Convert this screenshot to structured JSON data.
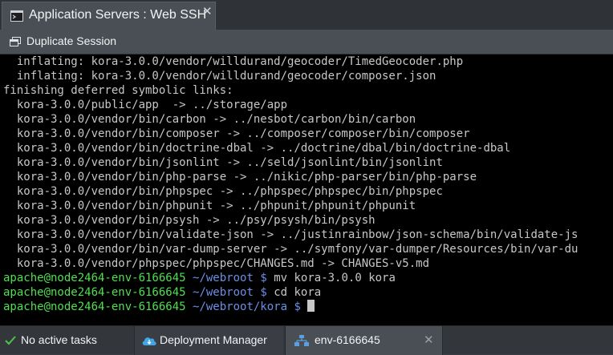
{
  "window": {
    "tab_title": "Application Servers : Web SSH",
    "tab_close": "✕"
  },
  "toolbar": {
    "duplicate_label": "Duplicate Session"
  },
  "terminal": {
    "output_lines": [
      "  inflating: kora-3.0.0/vendor/willdurand/geocoder/TimedGeocoder.php",
      "  inflating: kora-3.0.0/vendor/willdurand/geocoder/composer.json",
      "finishing deferred symbolic links:",
      "  kora-3.0.0/public/app  -> ../storage/app",
      "  kora-3.0.0/vendor/bin/carbon -> ../nesbot/carbon/bin/carbon",
      "  kora-3.0.0/vendor/bin/composer -> ../composer/composer/bin/composer",
      "  kora-3.0.0/vendor/bin/doctrine-dbal -> ../doctrine/dbal/bin/doctrine-dbal",
      "  kora-3.0.0/vendor/bin/jsonlint -> ../seld/jsonlint/bin/jsonlint",
      "  kora-3.0.0/vendor/bin/php-parse -> ../nikic/php-parser/bin/php-parse",
      "  kora-3.0.0/vendor/bin/phpspec -> ../phpspec/phpspec/bin/phpspec",
      "  kora-3.0.0/vendor/bin/phpunit -> ../phpunit/phpunit/phpunit",
      "  kora-3.0.0/vendor/bin/psysh -> ../psy/psysh/bin/psysh",
      "  kora-3.0.0/vendor/bin/validate-json -> ../justinrainbow/json-schema/bin/validate-js",
      "  kora-3.0.0/vendor/bin/var-dump-server -> ../symfony/var-dumper/Resources/bin/var-du",
      "  kora-3.0.0/vendor/phpspec/phpspec/CHANGES.md -> CHANGES-v5.md"
    ],
    "prompts": [
      {
        "user": "apache@node2464-env-6166645",
        "path": "~/webroot",
        "symbol": "$",
        "command": "mv kora-3.0.0 kora"
      },
      {
        "user": "apache@node2464-env-6166645",
        "path": "~/webroot",
        "symbol": "$",
        "command": "cd kora"
      },
      {
        "user": "apache@node2464-env-6166645",
        "path": "~/webroot/kora",
        "symbol": "$",
        "command": ""
      }
    ]
  },
  "taskbar": {
    "status_label": "No active tasks",
    "deployment_manager_label": "Deployment Manager",
    "env_label": "env-6166645",
    "env_close": "✕"
  },
  "colors": {
    "prompt_user": "#4ee04e",
    "prompt_path": "#6b8fe6",
    "terminal_text": "#c7c7c7",
    "terminal_bg": "#000000",
    "status_check": "#4cc24c",
    "cloud_icon": "#3fa7e6",
    "env_icon": "#5aa0e0"
  }
}
